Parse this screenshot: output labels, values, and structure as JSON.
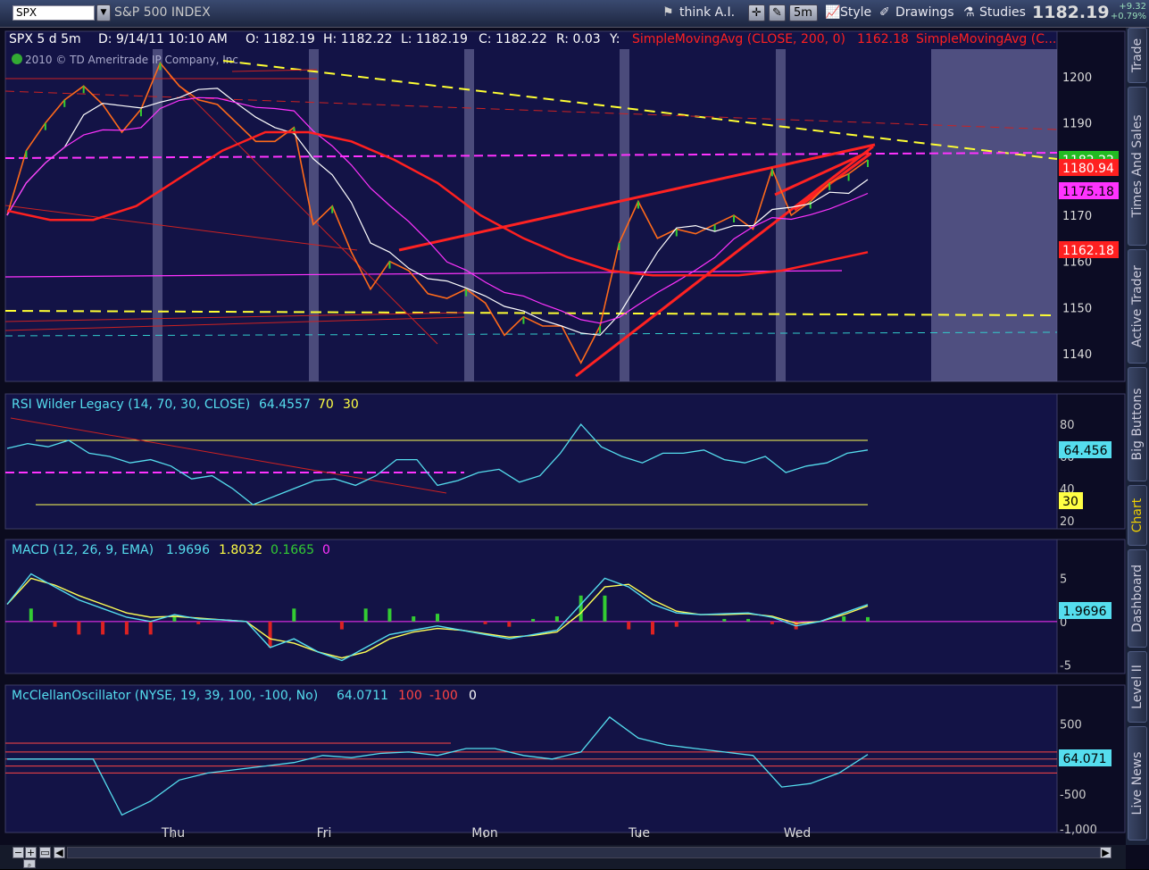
{
  "toolbar": {
    "symbol": "SPX",
    "symbol_desc": "S&P 500 INDEX",
    "think_ai": "think A.I.",
    "timeframe": "5m",
    "style": "Style",
    "drawings": "Drawings",
    "studies": "Studies",
    "last": "1182.19",
    "change": "+9.32",
    "change_pct": "+0.79%"
  },
  "side_tabs": [
    "Trade",
    "Times And Sales",
    "Active Trader",
    "Big Buttons",
    "Chart",
    "Dashboard",
    "Level II",
    "Live News"
  ],
  "active_tab": "Chart",
  "colors": {
    "background": "#0b0b1e",
    "plot_bg": "#131346",
    "weekend_band": "#5a5a88",
    "price_line": "#ff6a1a",
    "up_candle": "#33cc33",
    "sma200": "#ff2020",
    "trendline": "#ff2222",
    "dash_yellow": "#ffff33",
    "rsi": "#55ddee",
    "macd": "#55ddee",
    "signal": "#ffff55",
    "magenta": "#ff33ff"
  },
  "price_panel": {
    "header": {
      "symbol": "SPX 5 d 5m",
      "date": "D: 9/14/11 10:10 AM",
      "open": "O: 1182.19",
      "high": "H: 1182.22",
      "low": "L: 1182.19",
      "close": "C: 1182.22",
      "range": "R: 0.03",
      "y": "Y:",
      "study1": "SimpleMovingAvg (CLOSE, 200, 0)",
      "study1_val": "1162.18",
      "study2": "SimpleMovingAvg (C..."
    },
    "copyright": "2010 © TD Ameritrade IP Company, Inc.",
    "y_ticks": [
      "1200",
      "1190",
      "1180",
      "1170",
      "1160",
      "1150",
      "1140"
    ],
    "labels": [
      {
        "text": "1182.22",
        "color": "#22bb22",
        "fg": "#ffffff"
      },
      {
        "text": "1180.94",
        "color": "#ff2020",
        "fg": "#ffffff"
      },
      {
        "text": "1175.18",
        "color": "#ff33ff",
        "fg": "#000000"
      },
      {
        "text": "1162.18",
        "color": "#ff2020",
        "fg": "#ffffff"
      }
    ]
  },
  "rsi_panel": {
    "header": {
      "title": "RSI Wilder Legacy (14, 70, 30, CLOSE)",
      "value": "64.4557",
      "ob": "70",
      "os": "30"
    },
    "y_ticks": [
      "80",
      "60",
      "40",
      "20"
    ],
    "labels": [
      {
        "text": "64.456",
        "color": "#55ddee"
      },
      {
        "text": "30",
        "color": "#ffff44"
      }
    ]
  },
  "macd_panel": {
    "header": {
      "title": "MACD (12, 26, 9, EMA)",
      "value": "1.9696",
      "avg": "1.8032",
      "diff": "0.1665",
      "zero": "0"
    },
    "y_ticks": [
      "5",
      "0",
      "-5"
    ],
    "labels": [
      {
        "text": "1.9696",
        "color": "#55ddee"
      }
    ]
  },
  "mcclellan_panel": {
    "header": {
      "title": "McClellanOscillator (NYSE, 19, 39, 100, -100, No)",
      "value": "64.0711",
      "upper": "100",
      "lower": "-100",
      "zero": "0"
    },
    "y_ticks": [
      "500",
      "0",
      "-500",
      "-1,000"
    ],
    "labels": [
      {
        "text": "64.071",
        "color": "#55ddee"
      }
    ]
  },
  "x_axis": [
    "Thu",
    "Fri",
    "Mon",
    "Tue",
    "Wed"
  ],
  "chart_data": [
    {
      "type": "line",
      "title": "SPX 5 d 5m",
      "ylim": [
        1134,
        1206
      ],
      "series": [
        {
          "name": "SPX",
          "values": [
            1170,
            1184,
            1190,
            1195,
            1198,
            1194,
            1188,
            1193,
            1203,
            1198,
            1195,
            1194,
            1190,
            1186,
            1186,
            1189,
            1168,
            1172,
            1162,
            1154,
            1160,
            1158,
            1153,
            1152,
            1154,
            1151,
            1144,
            1148,
            1146,
            1146,
            1138,
            1146,
            1164,
            1173,
            1165,
            1167,
            1166,
            1168,
            1170,
            1167,
            1180,
            1170,
            1173,
            1177,
            1179,
            1182
          ]
        },
        {
          "name": "SimpleMovingAvg (CLOSE, 200, 0)",
          "values": [
            1171,
            1169,
            1169,
            1172,
            1178,
            1184,
            1188,
            1188,
            1186,
            1182,
            1177,
            1170,
            1165,
            1161,
            1158,
            1157,
            1157,
            1157,
            1158,
            1160,
            1162
          ]
        }
      ]
    },
    {
      "type": "line",
      "title": "RSI Wilder Legacy (14, 70, 30, CLOSE)",
      "ylim": [
        15,
        85
      ],
      "series": [
        {
          "name": "RSI",
          "values": [
            65,
            68,
            66,
            70,
            62,
            60,
            56,
            58,
            54,
            46,
            48,
            40,
            30,
            35,
            40,
            45,
            46,
            42,
            48,
            58,
            58,
            42,
            45,
            50,
            52,
            44,
            48,
            62,
            80,
            66,
            60,
            56,
            62,
            62,
            64,
            58,
            56,
            60,
            50,
            54,
            56,
            62,
            64
          ]
        }
      ]
    },
    {
      "type": "line",
      "title": "MACD (12, 26, 9, EMA)",
      "ylim": [
        -6,
        7
      ],
      "series": [
        {
          "name": "MACD",
          "values": [
            2,
            5.5,
            4,
            2.5,
            1.5,
            0.5,
            0,
            0.8,
            0.3,
            0.2,
            0,
            -3,
            -2,
            -3.5,
            -4.5,
            -3,
            -1.5,
            -1,
            -0.5,
            -1,
            -1.5,
            -2,
            -1.5,
            -1,
            2,
            5,
            4,
            2,
            1,
            0.8,
            0.9,
            1,
            0.5,
            -0.5,
            0,
            1,
            1.97
          ]
        },
        {
          "name": "Signal",
          "values": [
            2,
            5,
            4.2,
            3,
            2,
            1,
            0.5,
            0.6,
            0.4,
            0.2,
            0,
            -2,
            -2.5,
            -3.5,
            -4.2,
            -3.5,
            -2,
            -1.2,
            -0.8,
            -1,
            -1.4,
            -1.8,
            -1.6,
            -1.2,
            1,
            4,
            4.3,
            2.5,
            1.2,
            0.8,
            0.8,
            0.9,
            0.6,
            -0.2,
            0,
            0.8,
            1.8
          ]
        }
      ]
    },
    {
      "type": "line",
      "title": "McClellanOscillator (NYSE, 19, 39, 100, -100, No)",
      "ylim": [
        -1050,
        750
      ],
      "series": [
        {
          "name": "McClellan",
          "values": [
            0,
            0,
            0,
            0,
            -800,
            -600,
            -300,
            -200,
            -150,
            -100,
            -50,
            50,
            20,
            80,
            100,
            50,
            150,
            150,
            50,
            0,
            100,
            600,
            300,
            200,
            150,
            100,
            50,
            -400,
            -350,
            -200,
            64
          ]
        }
      ]
    }
  ]
}
